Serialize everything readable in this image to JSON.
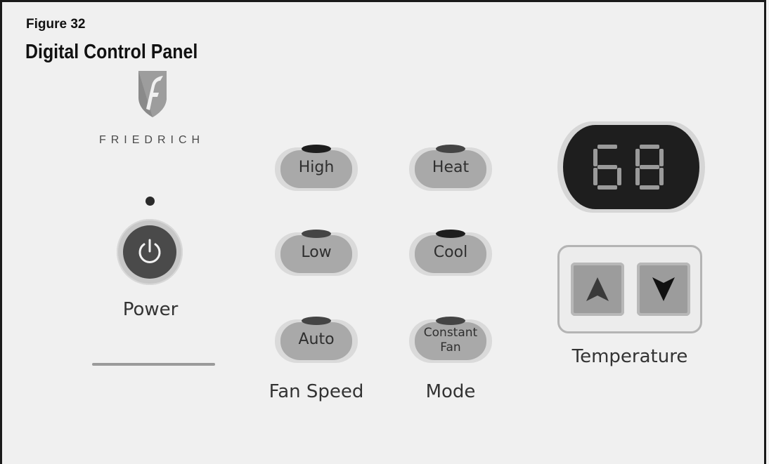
{
  "figure": {
    "number": "Figure 32",
    "title": "Digital Control Panel"
  },
  "brand": {
    "name": "FRIEDRICH",
    "logo_icon": "friedrich-shield-logo"
  },
  "power": {
    "label": "Power",
    "icon": "power-icon"
  },
  "fan_speed": {
    "label": "Fan Speed",
    "buttons": [
      {
        "label": "High",
        "led_on": true
      },
      {
        "label": "Low",
        "led_on": false
      },
      {
        "label": "Auto",
        "led_on": false
      }
    ]
  },
  "mode": {
    "label": "Mode",
    "buttons": [
      {
        "label": "Heat",
        "led_on": false
      },
      {
        "label": "Cool",
        "led_on": true
      },
      {
        "label": "Constant Fan",
        "label_line1": "Constant",
        "label_line2": "Fan",
        "led_on": false
      }
    ]
  },
  "temperature": {
    "label": "Temperature",
    "display_value": "68",
    "up_icon": "arrow-up-icon",
    "down_icon": "arrow-down-icon"
  },
  "colors": {
    "background": "#f0f0f0",
    "button_face": "#a9a9a9",
    "display_bg": "#1e1e1e",
    "segment": "#9a9a9a"
  }
}
